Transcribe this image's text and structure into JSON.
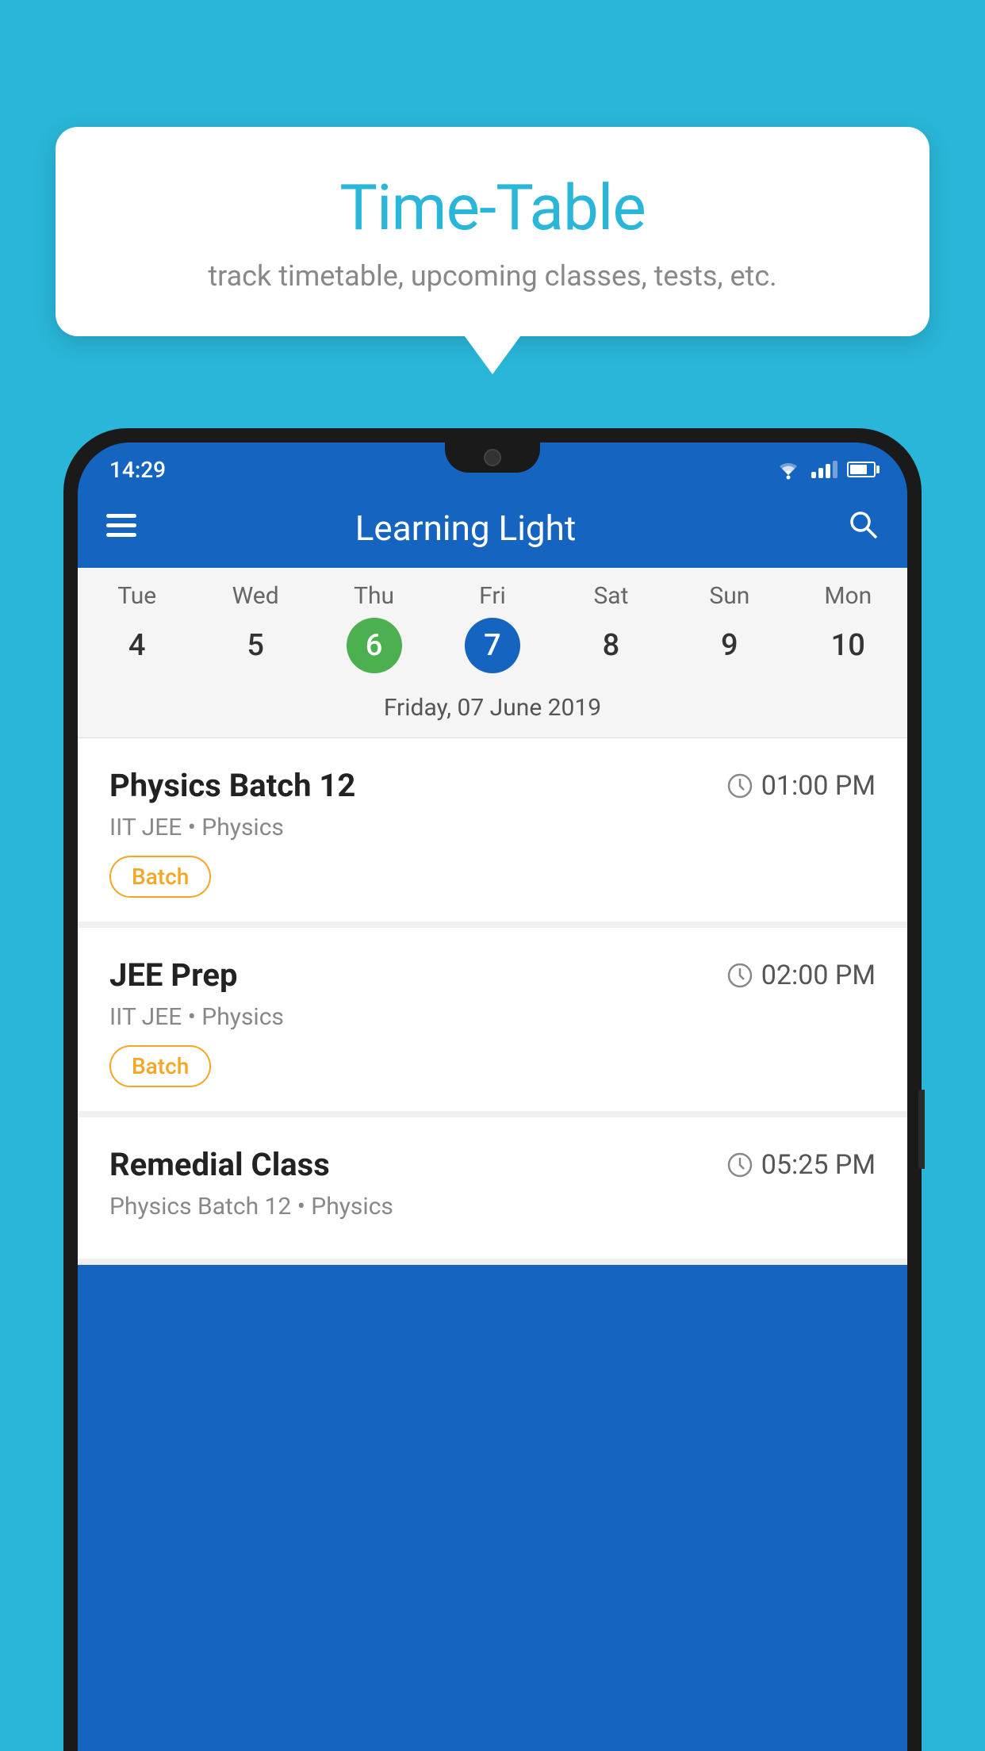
{
  "background_color": "#29B6D8",
  "speech_bubble": {
    "title": "Time-Table",
    "subtitle": "track timetable, upcoming classes, tests, etc."
  },
  "phone": {
    "status_bar": {
      "time": "14:29"
    },
    "app_bar": {
      "title": "Learning Light"
    },
    "calendar": {
      "days": [
        "Tue",
        "Wed",
        "Thu",
        "Fri",
        "Sat",
        "Sun",
        "Mon"
      ],
      "dates": [
        "4",
        "5",
        "6",
        "7",
        "8",
        "9",
        "10"
      ],
      "today_index": 2,
      "selected_index": 3,
      "selected_date_label": "Friday, 07 June 2019"
    },
    "classes": [
      {
        "name": "Physics Batch 12",
        "time": "01:00 PM",
        "meta": "IIT JEE • Physics",
        "badge": "Batch"
      },
      {
        "name": "JEE Prep",
        "time": "02:00 PM",
        "meta": "IIT JEE • Physics",
        "badge": "Batch"
      },
      {
        "name": "Remedial Class",
        "time": "05:25 PM",
        "meta": "Physics Batch 12 • Physics",
        "badge": ""
      }
    ]
  }
}
